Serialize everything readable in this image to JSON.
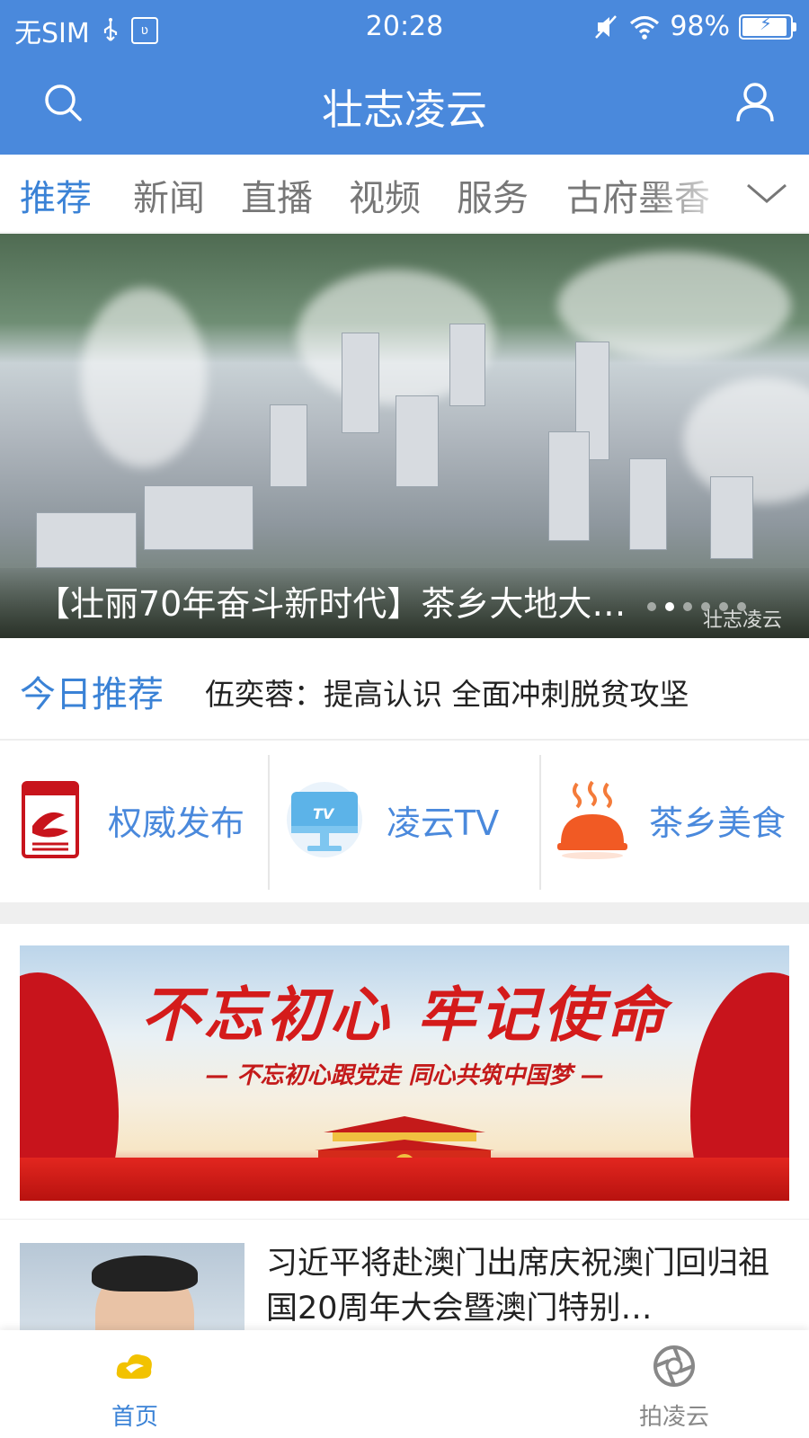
{
  "status_bar": {
    "carrier": "无SIM",
    "usb_badge": "ʋ",
    "time": "20:28",
    "battery_pct_text": "98%",
    "battery_level": 0.98
  },
  "app_bar": {
    "title": "壮志凌云"
  },
  "tabs": [
    {
      "label": "推荐",
      "active": true
    },
    {
      "label": "新闻",
      "active": false
    },
    {
      "label": "直播",
      "active": false
    },
    {
      "label": "视频",
      "active": false
    },
    {
      "label": "服务",
      "active": false
    },
    {
      "label": "古府墨香",
      "active": false
    }
  ],
  "hero": {
    "caption": "【壮丽70年奋斗新时代】茶乡大地大…",
    "watermark": "壮志凌云",
    "carousel_total": 6,
    "carousel_active": 1
  },
  "today": {
    "label": "今日推荐",
    "headline": "伍奕蓉：提高认识 全面冲刺脱贫攻坚"
  },
  "shortcuts": [
    {
      "label": "权威发布",
      "icon": "authority-doc-icon"
    },
    {
      "label": "凌云TV",
      "icon": "tv-icon",
      "icon_text": "TV"
    },
    {
      "label": "茶乡美食",
      "icon": "food-dish-icon"
    }
  ],
  "banner": {
    "headline": "不忘初心  牢记使命",
    "subline": "— 不忘初心跟党走 同心共筑中国梦 —"
  },
  "news": [
    {
      "title": "习近平将赴澳门出席庆祝澳门回归祖国20周年大会暨澳门特别…"
    }
  ],
  "bottom_nav": [
    {
      "label": "首页",
      "active": true,
      "icon": "home-cloud-icon"
    },
    {
      "label": "拍凌云",
      "active": false,
      "icon": "aperture-icon"
    }
  ],
  "colors": {
    "primary": "#4a89dc",
    "active_text": "#3a82d6",
    "banner_red": "#d41b1b"
  }
}
